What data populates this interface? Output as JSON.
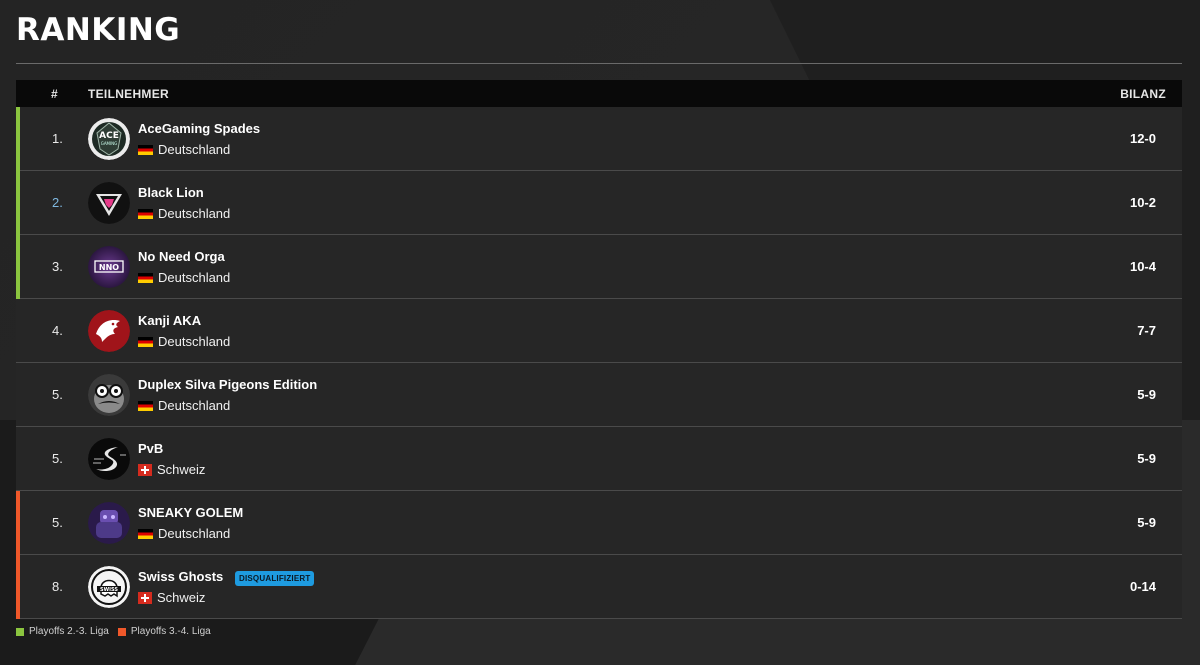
{
  "page_title": "RANKING",
  "table": {
    "header": {
      "rank": "#",
      "team": "TEILNEHMER",
      "record": "BILANZ"
    },
    "rows": [
      {
        "rank": "1.",
        "name": "AceGaming Spades",
        "country": "Deutschland",
        "flag": "de-flag",
        "record": "12-0",
        "status": "playoffs-2-3",
        "logo": "ace-gaming-logo"
      },
      {
        "rank": "2.",
        "name": "Black Lion",
        "country": "Deutschland",
        "flag": "de-flag",
        "record": "10-2",
        "status": "playoffs-2-3",
        "logo": "black-lion-logo"
      },
      {
        "rank": "3.",
        "name": "No Need Orga",
        "country": "Deutschland",
        "flag": "de-flag",
        "record": "10-4",
        "status": "playoffs-2-3",
        "logo": "nno-logo"
      },
      {
        "rank": "4.",
        "name": "Kanji AKA",
        "country": "Deutschland",
        "flag": "de-flag",
        "record": "7-7",
        "status": "",
        "logo": "eagle-logo"
      },
      {
        "rank": "5.",
        "name": "Duplex Silva Pigeons Edition",
        "country": "Deutschland",
        "flag": "de-flag",
        "record": "5-9",
        "status": "",
        "logo": "pigeon-logo"
      },
      {
        "rank": "5.",
        "name": "PvB",
        "country": "Schweiz",
        "flag": "ch-flag",
        "record": "5-9",
        "status": "",
        "logo": "pvb-logo"
      },
      {
        "rank": "5.",
        "name": "SNEAKY GOLEM",
        "country": "Deutschland",
        "flag": "de-flag",
        "record": "5-9",
        "status": "playoffs-3-4",
        "logo": "golem-logo"
      },
      {
        "rank": "8.",
        "name": "Swiss Ghosts",
        "country": "Schweiz",
        "flag": "ch-flag",
        "record": "0-14",
        "status": "playoffs-3-4",
        "badge": "DISQUALIFIZIERT",
        "logo": "swiss-ghosts-logo"
      }
    ]
  },
  "legend": [
    {
      "label": "Playoffs 2.-3. Liga",
      "color": "#8bc53f"
    },
    {
      "label": "Playoffs 3.-4. Liga",
      "color": "#f0582a"
    }
  ],
  "colors": {
    "playoffs-2-3": "#8bc53f",
    "playoffs-3-4": "#f0582a",
    "badge": "#1e9be0"
  }
}
